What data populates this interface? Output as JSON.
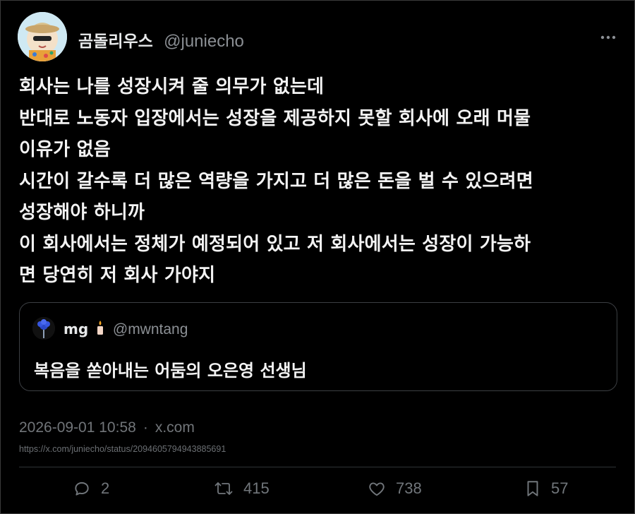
{
  "author": {
    "display_name": "곰돌리우스",
    "handle": "@juniecho",
    "avatar_icon": "cartoon-character-avatar"
  },
  "tweet": {
    "text": "회사는 나를 성장시켜 줄 의무가 없는데\n반대로 노동자 입장에서는 성장을 제공하지 못할 회사에 오래 머물\n이유가 없음\n시간이 갈수록 더 많은 역량을 가지고 더 많은 돈을 벌 수 있으려면\n성장해야 하니까\n이 회사에서는 정체가 예정되어 있고 저 회사에서는 성장이 가능하\n면 당연히 저 회사 가야지"
  },
  "quote": {
    "display_name": "mg",
    "name_emoji": "candle-icon",
    "handle": "@mwntang",
    "avatar_icon": "blue-flower-avatar",
    "text": "복음을 쏟아내는 어둠의 오은영 선생님"
  },
  "meta": {
    "timestamp": "2026-09-01 10:58",
    "separator": "·",
    "source": "x.com",
    "status_url": "https://x.com/juniecho/status/2094605794943885691"
  },
  "actions": {
    "replies": "2",
    "reposts": "415",
    "likes": "738",
    "bookmarks": "57"
  },
  "colors": {
    "background": "#000000",
    "text": "#e7e9ea",
    "muted": "#71767b",
    "border": "#2f3336"
  }
}
